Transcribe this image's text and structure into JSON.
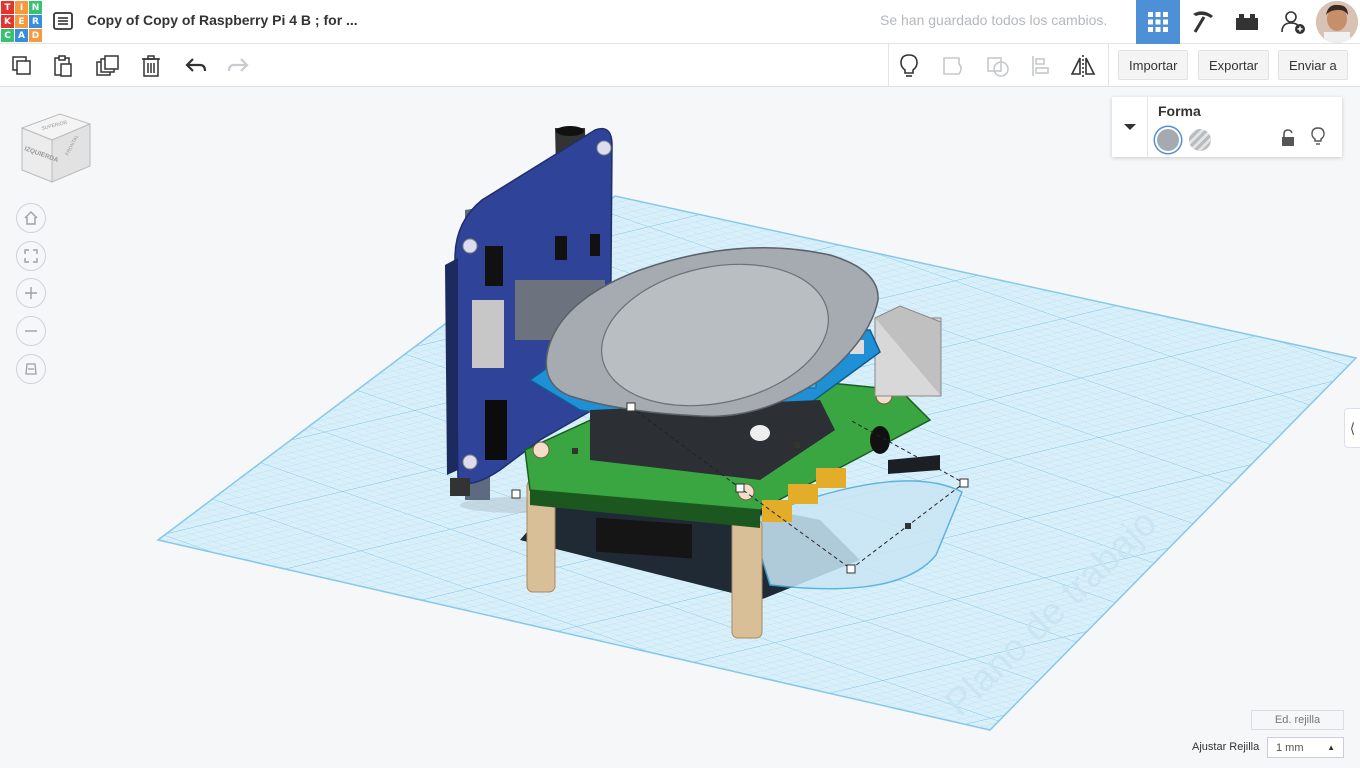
{
  "app": {
    "logo_letters": [
      "T",
      "I",
      "N",
      "K",
      "E",
      "R",
      "C",
      "A",
      "D"
    ],
    "logo_colors": [
      "#e3342f",
      "#f6993f",
      "#38c172",
      "#e3342f",
      "#f6993f",
      "#3490dc",
      "#38c172",
      "#3490dc",
      "#f6993f"
    ]
  },
  "header": {
    "title": "Copy of Copy of Raspberry Pi 4 B ; for ...",
    "saved_status": "Se han guardado todos los cambios.",
    "icons": [
      "grid-view-icon",
      "pickaxe-icon",
      "bricks-icon",
      "add-user-icon"
    ]
  },
  "toolbar": {
    "left_tools": [
      "copy-icon",
      "paste-icon",
      "duplicate-icon",
      "trash-icon",
      "undo-icon",
      "redo-icon"
    ],
    "right_tools": [
      "lightbulb-icon",
      "group-icon",
      "ungroup-icon",
      "align-icon",
      "mirror-icon"
    ],
    "import_label": "Importar",
    "export_label": "Exportar",
    "send_label": "Enviar a"
  },
  "viewcube": {
    "left_face": "IZQUIERDA",
    "front_face": "FRONTAL",
    "top_face": "SUPERIOR"
  },
  "nav": [
    "home-icon",
    "fit-view-icon",
    "zoom-in-icon",
    "zoom-out-icon",
    "perspective-icon"
  ],
  "shape_panel": {
    "title": "Forma",
    "solid_color": "#a4aab0",
    "hole_label": "hole"
  },
  "workplane": {
    "label": "Plano de trabajo",
    "edit_grid": "Ed. rejilla",
    "snap_label": "Ajustar Rejilla",
    "snap_value": "1 mm"
  },
  "colors": {
    "accent": "#4d90d6",
    "grid": "#9dd3ee",
    "board_blue": "#2c3e8a",
    "board_green": "#3daa42"
  }
}
